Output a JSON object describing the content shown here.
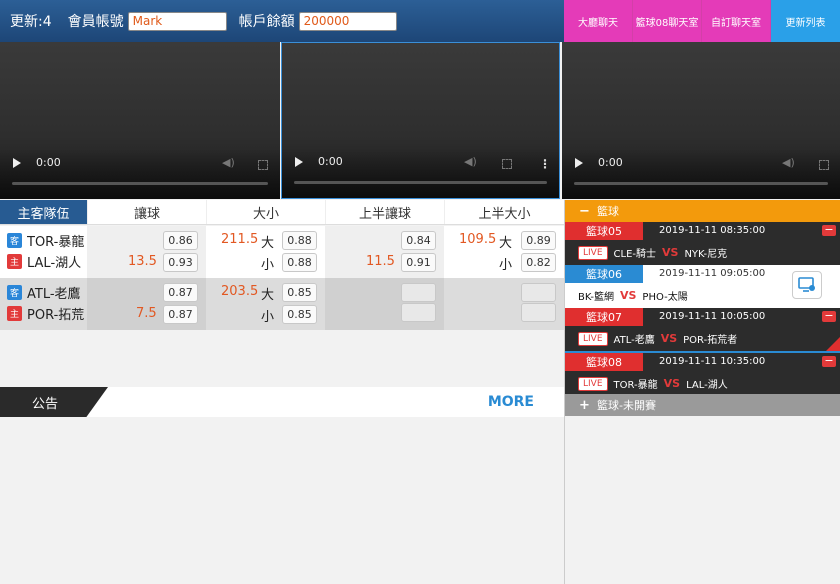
{
  "header": {
    "update_label": "更新:4",
    "account_label": "會員帳號",
    "account_value": "Mark",
    "balance_label": "帳戶餘額",
    "balance_value": "200000"
  },
  "buttons": [
    "大廳聊天",
    "籃球08聊天室",
    "自訂聊天室",
    "更新列表"
  ],
  "video": {
    "time": "0:00",
    "volume_icon": "speaker-icon",
    "fullscreen_icon": "fullscreen-icon",
    "menu_icon": "more-vert-icon"
  },
  "odds_table": {
    "headers": [
      "主客隊伍",
      "讓球",
      "大小",
      "上半讓球",
      "上半大小"
    ],
    "away_tag": "客",
    "home_tag": "主",
    "big_label": "大",
    "small_label": "小",
    "rows": [
      {
        "away": "TOR-暴龍",
        "home": "LAL-湖人",
        "hcp_line": "13.5",
        "hcp_odds": [
          "0.86",
          "0.93"
        ],
        "ou_line": "211.5",
        "ou_odds": [
          "0.88",
          "0.88"
        ],
        "h1_hcp_line": "11.5",
        "h1_hcp_odds": [
          "0.84",
          "0.91"
        ],
        "h1_ou_line": "109.5",
        "h1_ou_odds": [
          "0.89",
          "0.82"
        ]
      },
      {
        "away": "ATL-老鷹",
        "home": "POR-拓荒",
        "hcp_line": "7.5",
        "hcp_odds": [
          "0.87",
          "0.87"
        ],
        "ou_line": "203.5",
        "ou_odds": [
          "0.85",
          "0.85"
        ],
        "h1_hcp_line": "",
        "h1_hcp_odds": [
          "",
          ""
        ],
        "h1_ou_line": "",
        "h1_ou_odds": [
          "",
          ""
        ]
      }
    ]
  },
  "announcement": {
    "tab": "公告",
    "more": "MORE"
  },
  "panel": {
    "open_sign": "−",
    "closed_sign": "+",
    "section_open": "籃球",
    "section_closed": "籃球-未開賽",
    "live_label": "LIVE",
    "vs_label": "VS",
    "close_sign": "−",
    "games": [
      {
        "tag": "籃球05",
        "time": "2019-11-11 08:35:00",
        "away": "CLE-騎士",
        "home": "NYK-尼克"
      },
      {
        "tag": "籃球06",
        "time": "2019-11-11 09:05:00",
        "away": "BK-籃網",
        "home": "PHO-太陽"
      },
      {
        "tag": "籃球07",
        "time": "2019-11-11 10:05:00",
        "away": "ATL-老鷹",
        "home": "POR-拓荒者"
      },
      {
        "tag": "籃球08",
        "time": "2019-11-11 10:35:00",
        "away": "TOR-暴龍",
        "home": "LAL-湖人"
      }
    ]
  }
}
